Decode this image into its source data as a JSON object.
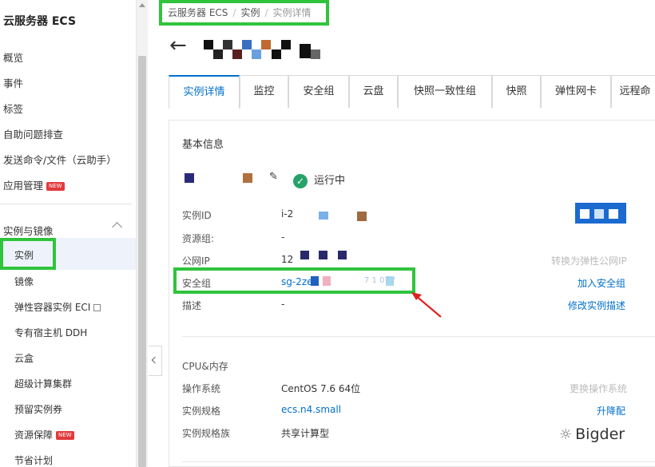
{
  "sidebar": {
    "title": "云服务器 ECS",
    "items": [
      {
        "label": "概览"
      },
      {
        "label": "事件"
      },
      {
        "label": "标签"
      },
      {
        "label": "自助问题排查"
      },
      {
        "label": "发送命令/文件（云助手）"
      },
      {
        "label": "应用管理",
        "badge": "NEW"
      }
    ],
    "group": {
      "label": "实例与镜像",
      "items": [
        {
          "label": "实例"
        },
        {
          "label": "镜像"
        },
        {
          "label": "弹性容器实例 ECI"
        },
        {
          "label": "专有宿主机 DDH"
        },
        {
          "label": "云盒"
        },
        {
          "label": "超级计算集群"
        },
        {
          "label": "预留实例券"
        },
        {
          "label": "资源保障",
          "badge": "NEW"
        },
        {
          "label": "节省计划"
        }
      ]
    }
  },
  "breadcrumb": {
    "items": [
      "云服务器 ECS",
      "实例",
      "实例详情"
    ],
    "sep": "/"
  },
  "tabs": [
    "实例详情",
    "监控",
    "安全组",
    "云盘",
    "快照一致性组",
    "快照",
    "弹性网卡",
    "远程命"
  ],
  "basic_info": {
    "title": "基本信息",
    "status": "运行中",
    "rows": [
      {
        "label": "实例ID",
        "value": "i-2"
      },
      {
        "label": "资源组:",
        "value": "-"
      },
      {
        "label": "公网IP",
        "value": "12",
        "action": "转换为弹性公网IP"
      },
      {
        "label": "安全组",
        "value": "sg-2ze",
        "value_tail": "7 1 07 /",
        "action": "加入安全组"
      },
      {
        "label": "描述",
        "value": "-",
        "action": "修改实例描述"
      }
    ]
  },
  "spec": {
    "rows": [
      {
        "label": "CPU&内存",
        "value": ""
      },
      {
        "label": "操作系统",
        "value": "CentOS 7.6 64位",
        "action": "更换操作系统"
      },
      {
        "label": "实例规格",
        "value": "ecs.n4.small",
        "action": "升降配"
      },
      {
        "label": "实例规格族",
        "value": "共享计算型"
      }
    ]
  },
  "watermark": "Bigder",
  "colors": {
    "accent": "#0070cc",
    "highlight": "#2fc43c",
    "arrow": "#e02020",
    "running": "#26a269"
  }
}
